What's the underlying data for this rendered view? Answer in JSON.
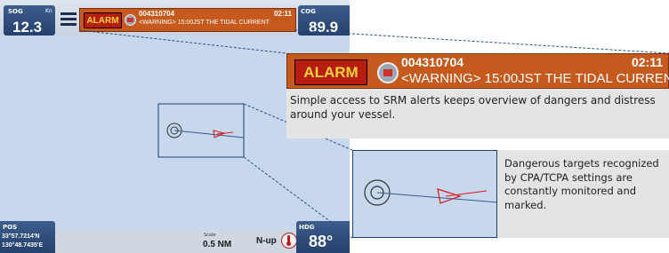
{
  "sog": {
    "label": "SOG",
    "unit": "Kn",
    "value": "12.3"
  },
  "cog": {
    "label": "COG",
    "value": "89.9"
  },
  "alarm": {
    "button_label": "ALARM",
    "mmsi": "004310704",
    "time": "02:11",
    "message": "<WARNING> 15:00JST THE TIDAL CURRENT"
  },
  "pos": {
    "label": "POS",
    "lat": "33°57.7214'N",
    "lon": "130°48.7435'E"
  },
  "scale": {
    "label": "Scale",
    "value": "0.5 NM"
  },
  "orientation": "N-up",
  "hdg": {
    "label": "HDG",
    "value": "88°"
  },
  "callouts": {
    "srm": "Simple access to SRM alerts keeps overview of dangers and distress around your vessel.",
    "targets": "Dangerous targets recognized by CPA/TCPA settings are constantly monitored and marked."
  },
  "colors": {
    "alarm_red": "#b81d11",
    "alarm_text": "#ffd23a",
    "panel_orange": "#c65a1e",
    "panel_blue": "#2a4a7a",
    "map_sea": "#c7d7ec"
  }
}
